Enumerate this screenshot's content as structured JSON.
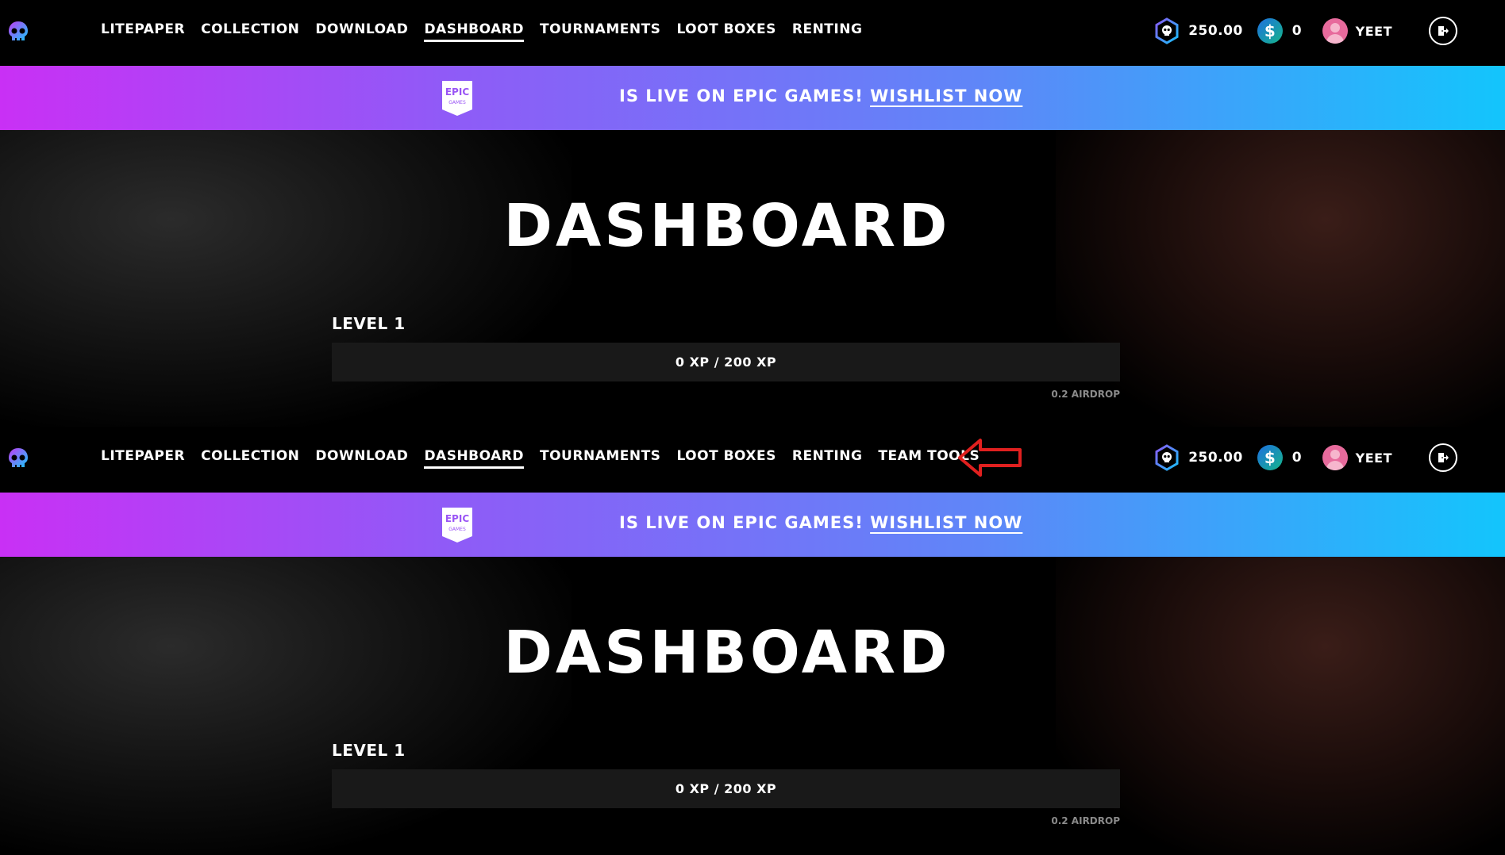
{
  "nav": {
    "links": [
      "LITEPAPER",
      "COLLECTION",
      "DOWNLOAD",
      "DASHBOARD",
      "TOURNAMENTS",
      "LOOT BOXES",
      "RENTING"
    ],
    "links_with_team_tools": [
      "LITEPAPER",
      "COLLECTION",
      "DOWNLOAD",
      "DASHBOARD",
      "TOURNAMENTS",
      "LOOT BOXES",
      "RENTING",
      "TEAM TOOLS"
    ],
    "active": "DASHBOARD",
    "token_balance": "250.00",
    "cash_symbol": "$",
    "cash_balance": "0",
    "username": "YEET",
    "icons": [
      "skull-logo-icon",
      "token-icon",
      "cash-icon",
      "avatar",
      "logout-icon"
    ]
  },
  "banner": {
    "logo_text_1": "EPIC",
    "logo_text_2": "GAMES",
    "text": "IS LIVE ON EPIC GAMES!",
    "link": "WISHLIST NOW"
  },
  "hero": {
    "title": "DASHBOARD",
    "level": "LEVEL 1",
    "xp_text": "0 XP / 200 XP",
    "xp_progress": 0,
    "airdrop": "0.2 AIRDROP"
  },
  "colors": {
    "banner_start": "#c930f5",
    "banner_end": "#13c5fc",
    "annotation_arrow": "#e0201f"
  }
}
